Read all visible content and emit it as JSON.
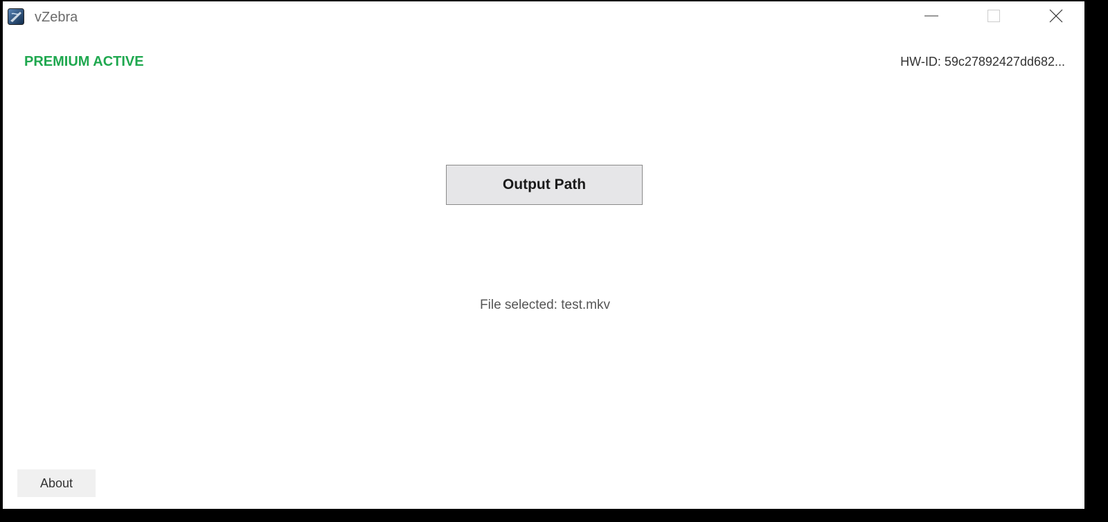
{
  "window": {
    "title": "vZebra",
    "controls": {
      "minimize_icon": "minimize-icon",
      "maximize_icon": "maximize-icon",
      "close_icon": "close-icon"
    }
  },
  "status": {
    "premium_label": "PREMIUM ACTIVE",
    "premium_color": "#1fa84f",
    "hwid_text": "HW-ID: 59c27892427dd682..."
  },
  "main": {
    "output_button_label": "Output Path",
    "file_selected_text": "File selected: test.mkv"
  },
  "footer": {
    "about_label": "About"
  },
  "icons": {
    "app_icon": "vzebra-app-icon"
  }
}
